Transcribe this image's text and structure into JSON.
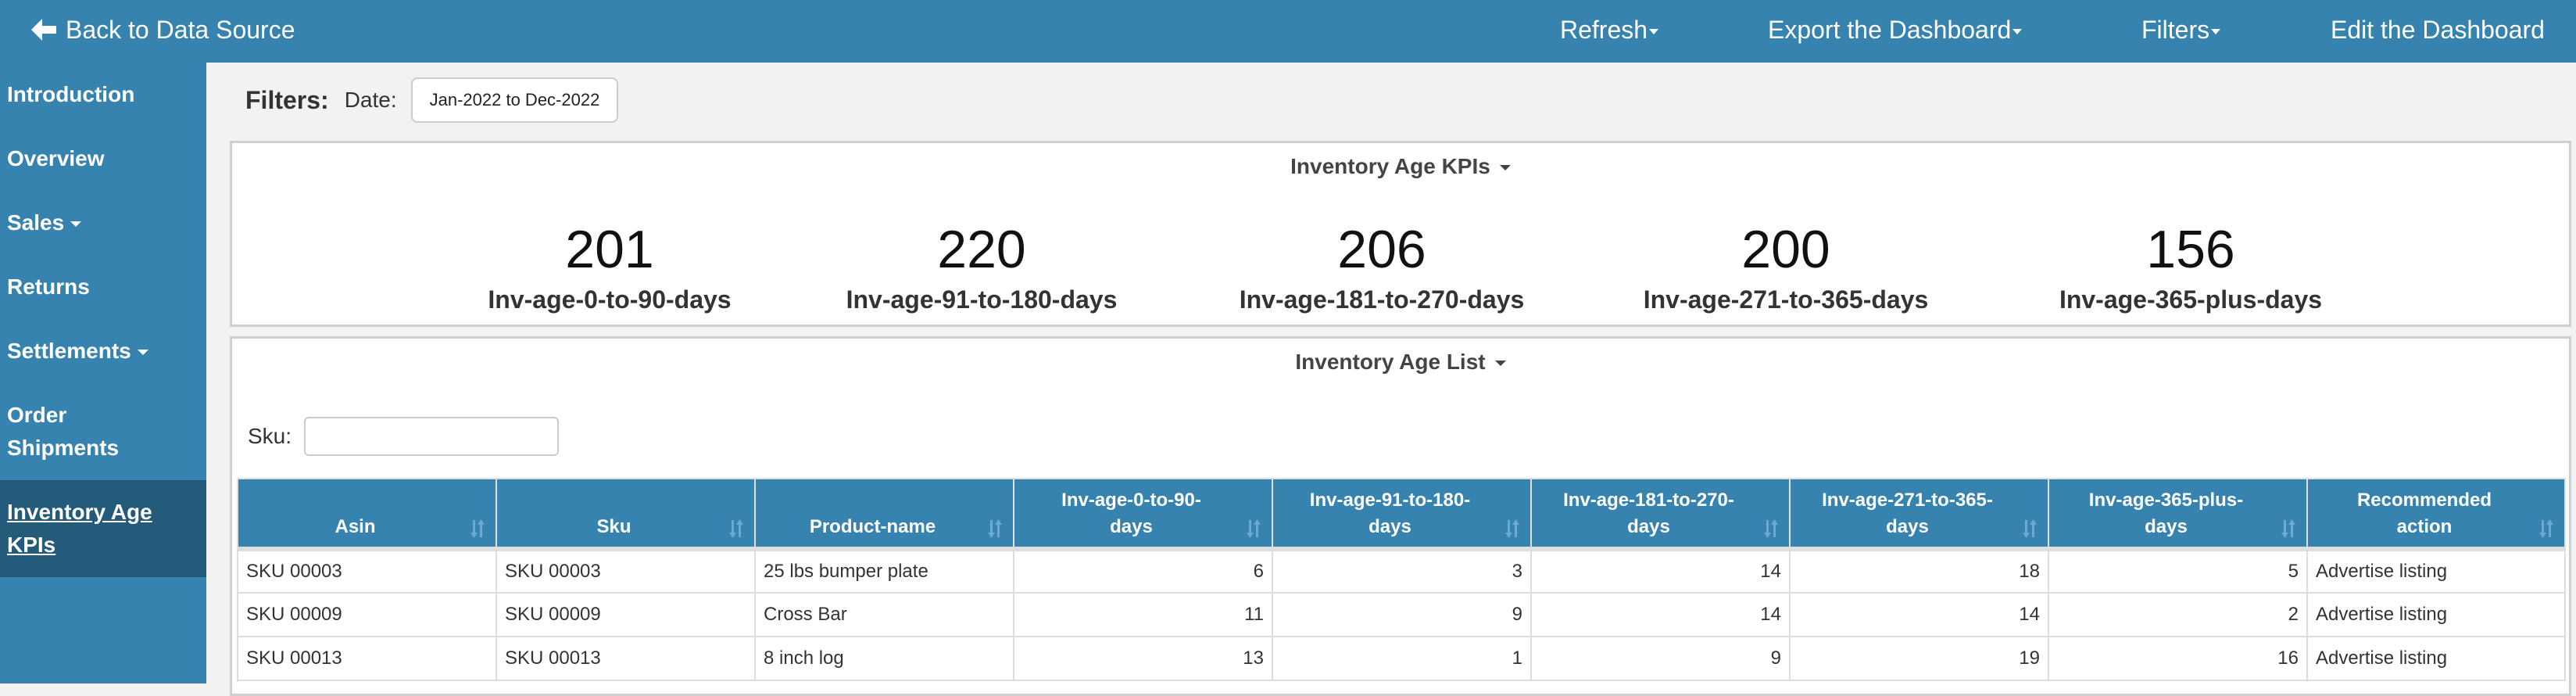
{
  "topbar": {
    "back_label": "Back to Data Source",
    "nav": [
      {
        "label": "Refresh",
        "has_caret": true
      },
      {
        "label": "Export the Dashboard",
        "has_caret": true
      },
      {
        "label": "Filters",
        "has_caret": true
      },
      {
        "label": "Edit the Dashboard",
        "has_caret": false
      }
    ]
  },
  "sidebar": {
    "items": [
      {
        "label": "Introduction",
        "has_caret": false,
        "active": false
      },
      {
        "label": "Overview",
        "has_caret": false,
        "active": false
      },
      {
        "label": "Sales",
        "has_caret": true,
        "active": false
      },
      {
        "label": "Returns",
        "has_caret": false,
        "active": false
      },
      {
        "label": "Settlements",
        "has_caret": true,
        "active": false
      },
      {
        "label_line1": "Order",
        "label_line2": "Shipments",
        "has_caret": false,
        "active": false
      },
      {
        "label_line1": "Inventory Age",
        "label_line2": "KPIs",
        "has_caret": false,
        "active": true
      }
    ]
  },
  "filters": {
    "title": "Filters:",
    "date_label": "Date:",
    "date_value": "Jan-2022 to Dec-2022"
  },
  "kpi_panel": {
    "title": "Inventory Age KPIs",
    "kpis": [
      {
        "value": "201",
        "label": "Inv-age-0-to-90-days"
      },
      {
        "value": "220",
        "label": "Inv-age-91-to-180-days"
      },
      {
        "value": "206",
        "label": "Inv-age-181-to-270-days"
      },
      {
        "value": "200",
        "label": "Inv-age-271-to-365-days"
      },
      {
        "value": "156",
        "label": "Inv-age-365-plus-days"
      }
    ]
  },
  "list_panel": {
    "title": "Inventory Age List",
    "sku_label": "Sku:",
    "sku_value": "",
    "columns": [
      {
        "line1": "",
        "line2": "Asin"
      },
      {
        "line1": "",
        "line2": "Sku"
      },
      {
        "line1": "",
        "line2": "Product-name"
      },
      {
        "line1": "Inv-age-0-to-90-",
        "line2": "days"
      },
      {
        "line1": "Inv-age-91-to-180-",
        "line2": "days"
      },
      {
        "line1": "Inv-age-181-to-270-",
        "line2": "days"
      },
      {
        "line1": "Inv-age-271-to-365-",
        "line2": "days"
      },
      {
        "line1": "Inv-age-365-plus-",
        "line2": "days"
      },
      {
        "line1": "Recommended",
        "line2": "action"
      }
    ],
    "rows": [
      [
        "SKU 00003",
        "SKU 00003",
        "25 lbs bumper plate",
        "6",
        "3",
        "14",
        "18",
        "5",
        "Advertise listing"
      ],
      [
        "SKU 00009",
        "SKU 00009",
        "Cross Bar",
        "11",
        "9",
        "14",
        "14",
        "2",
        "Advertise listing"
      ],
      [
        "SKU 00013",
        "SKU 00013",
        "8 inch log",
        "13",
        "1",
        "9",
        "19",
        "16",
        "Advertise listing"
      ]
    ]
  }
}
